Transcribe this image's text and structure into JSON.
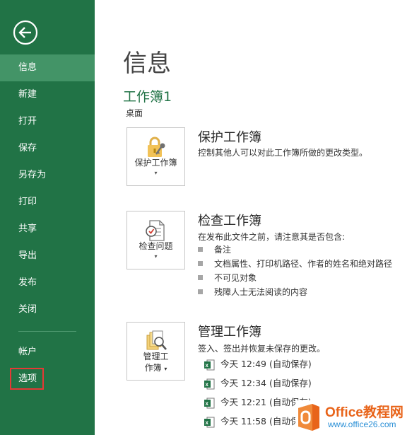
{
  "sidebar": {
    "items": [
      {
        "label": "信息",
        "active": true
      },
      {
        "label": "新建"
      },
      {
        "label": "打开"
      },
      {
        "label": "保存"
      },
      {
        "label": "另存为"
      },
      {
        "label": "打印"
      },
      {
        "label": "共享"
      },
      {
        "label": "导出"
      },
      {
        "label": "发布"
      },
      {
        "label": "关闭"
      }
    ],
    "bottom": [
      {
        "label": "帐户"
      },
      {
        "label": "选项",
        "highlighted": true
      }
    ],
    "accent": "#217346"
  },
  "main": {
    "title": "信息",
    "workbook_name": "工作簿1",
    "workbook_location": "桌面",
    "sections": [
      {
        "button_label": "保护工作簿",
        "icon": "lock-key-icon",
        "title": "保护工作簿",
        "description": "控制其他人可以对此工作簿所做的更改类型。"
      },
      {
        "button_label": "检查问题",
        "icon": "inspect-document-icon",
        "title": "检查工作簿",
        "description": "在发布此文件之前，请注意其是否包含:",
        "bullets": [
          "备注",
          "文档属性、打印机路径、作者的姓名和绝对路径",
          "不可见对象",
          "残障人士无法阅读的内容"
        ]
      },
      {
        "button_label_line1": "管理工",
        "button_label_line2": "作簿",
        "icon": "manage-workbook-icon",
        "title": "管理工作簿",
        "description": "签入、签出并恢复未保存的更改。",
        "versions": [
          "今天 12:49 (自动保存)",
          "今天 12:34 (自动保存)",
          "今天 12:21 (自动保存)",
          "今天 11:58 (自动保"
        ]
      }
    ]
  },
  "watermark": {
    "line1": "Office教程网",
    "line2": "www.office26.com"
  }
}
